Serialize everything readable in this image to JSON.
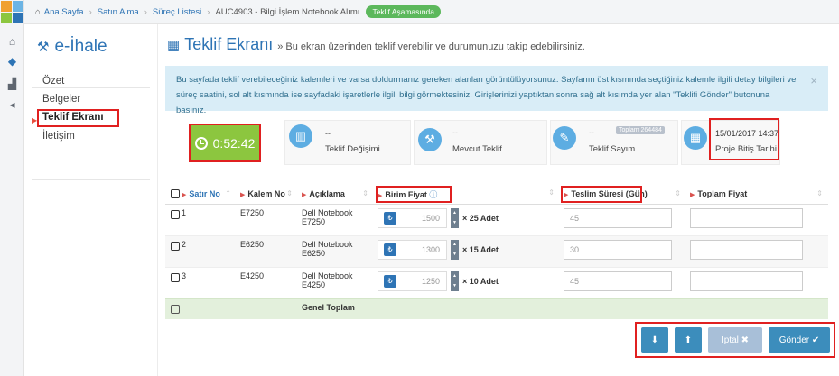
{
  "colors": {
    "brand": "#2e74b5",
    "timer": "#8cc63f",
    "success": "#5cb85c",
    "highlight": "#e02020"
  },
  "breadcrumb": {
    "home": "Ana Sayfa",
    "items": [
      "Satın Alma",
      "Süreç Listesi",
      "AUC4903 - Bilgi İşlem Notebook Alımı"
    ],
    "status": "Teklif Aşamasında"
  },
  "brand": "e-İhale",
  "sidebar": {
    "items": [
      "Özet",
      "Belgeler",
      "Teklif Ekranı",
      "İletişim"
    ]
  },
  "page": {
    "title": "Teklif Ekranı",
    "description": "» Bu ekran üzerinden teklif verebilir ve durumunuzu takip edebilirsiniz."
  },
  "alert": {
    "text": "Bu sayfada teklif verebileceğiniz kalemleri ve varsa doldurmanız gereken alanları görüntülüyorsunuz. Sayfanın üst kısmında seçtiğiniz kalemle ilgili detay bilgileri ve süreç saatini, sol alt kısmında ise sayfadaki işaretlerle ilgili bilgi görmektesiniz. Girişlerinizi yaptıktan sonra sağ alt kısımda yer alan \"Teklifi Gönder\" butonuna basınız.",
    "close": "×"
  },
  "stats": {
    "timer": "0:52:42",
    "change": {
      "value": "--",
      "label": "Teklif Değişimi"
    },
    "current": {
      "value": "--",
      "label": "Mevcut Teklif"
    },
    "count": {
      "value": "--",
      "label": "Teklif Sayım",
      "badge": "Toplam 264484"
    },
    "end": {
      "value": "15/01/2017 14:37",
      "label": "Proje Bitiş Tarihi"
    }
  },
  "table": {
    "headers": {
      "row_no": "Satır No",
      "item_no": "Kalem No",
      "desc": "Açıklama",
      "price": "Birim Fiyat",
      "delivery": "Teslim Süresi (Gün)",
      "total": "Toplam Fiyat"
    },
    "rows": [
      {
        "no": "1",
        "code": "E7250",
        "desc": "Dell Notebook E7250",
        "price": "1500",
        "qty": "× 25 Adet",
        "delivery": "45"
      },
      {
        "no": "2",
        "code": "E6250",
        "desc": "Dell Notebook E6250",
        "price": "1300",
        "qty": "× 15 Adet",
        "delivery": "30"
      },
      {
        "no": "3",
        "code": "E4250",
        "desc": "Dell Notebook E4250",
        "price": "1250",
        "qty": "× 10 Adet",
        "delivery": "45"
      }
    ],
    "total_label": "Genel Toplam"
  },
  "buttons": {
    "cancel": "İptal",
    "submit": "Gönder"
  }
}
